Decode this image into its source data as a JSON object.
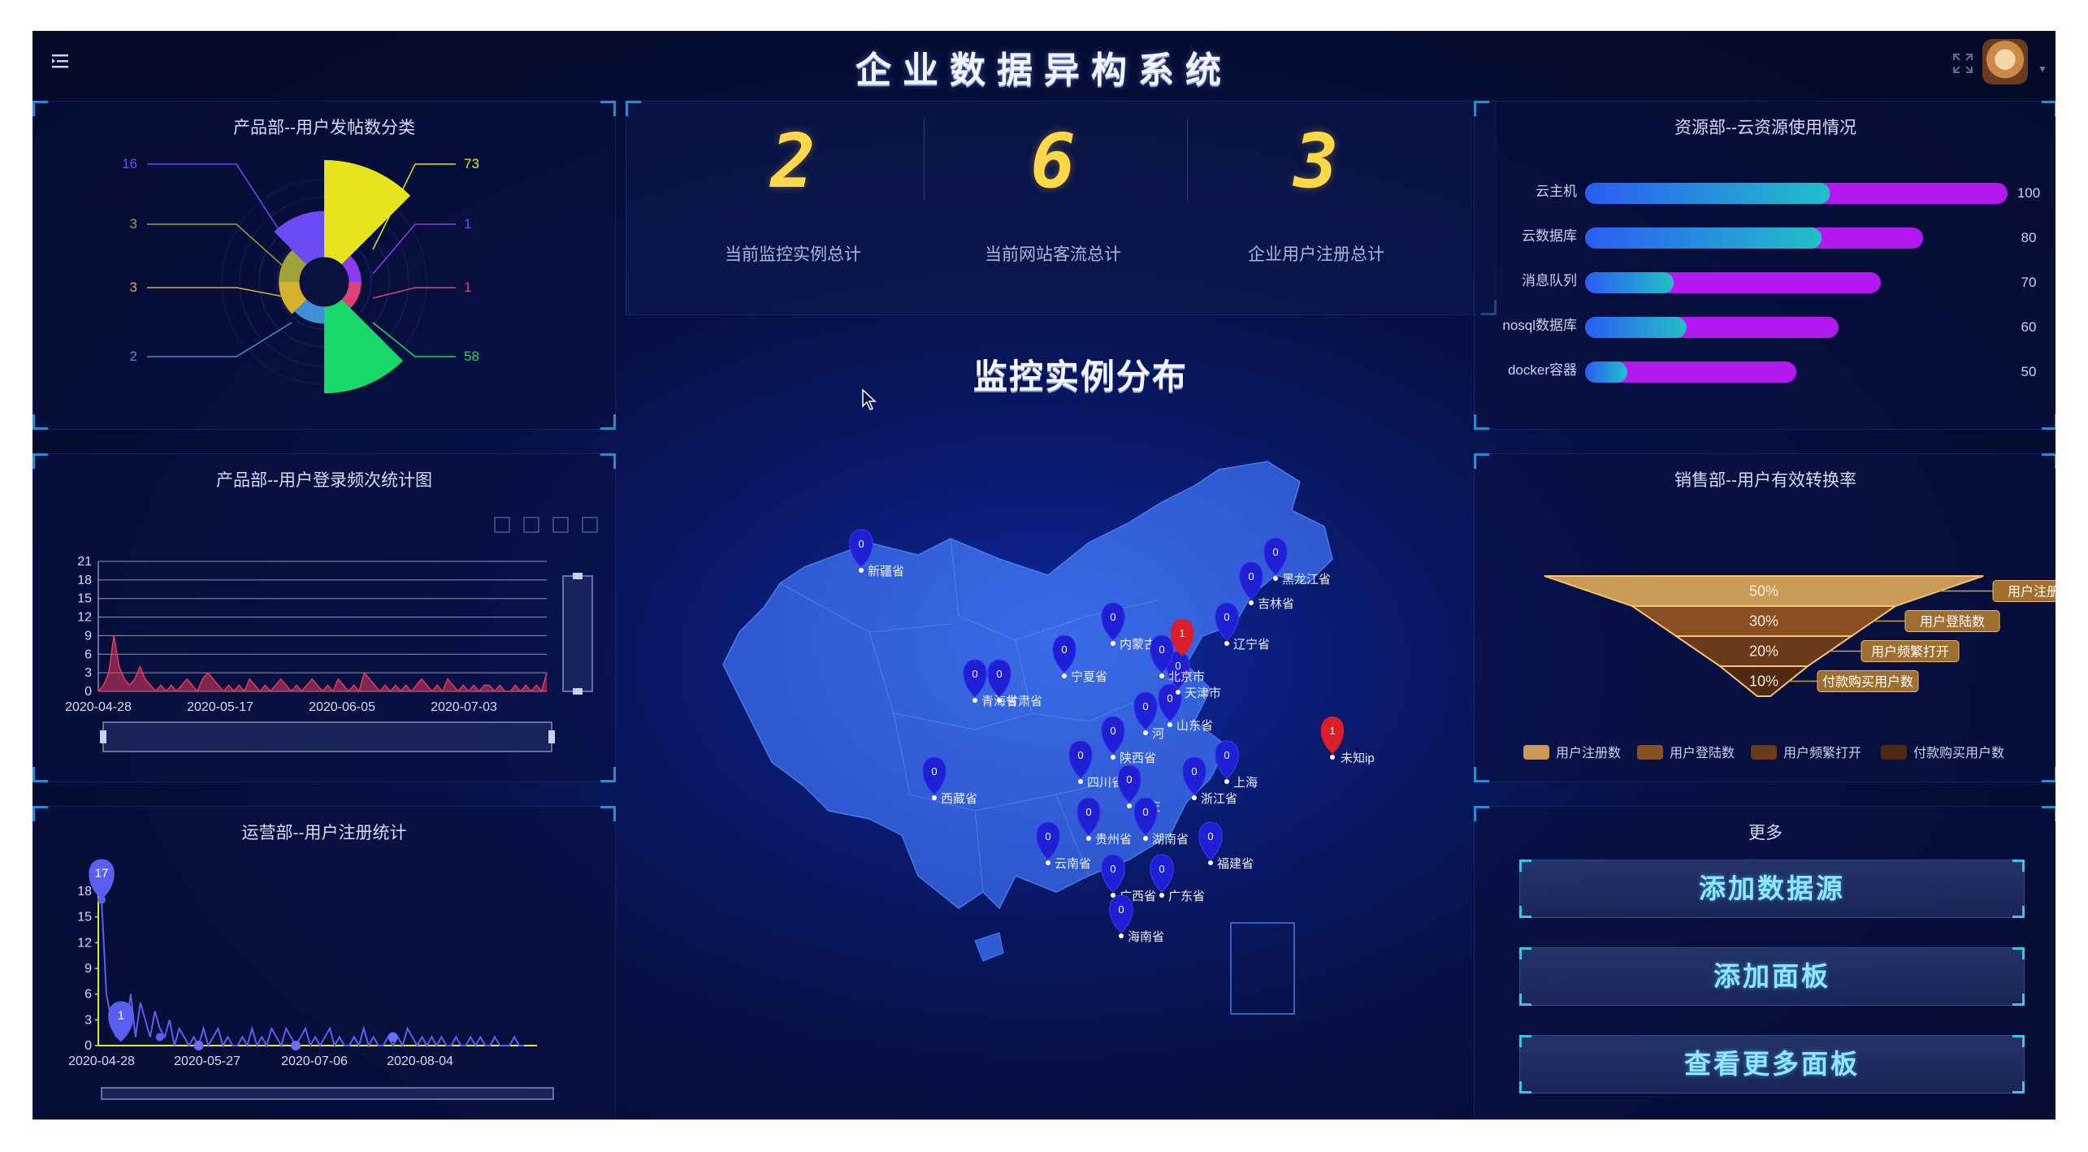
{
  "app": {
    "title": "企业数据异构系统"
  },
  "header": {
    "menu_icon": "menu-fold-icon",
    "fullscreen_icon": "fullscreen-icon",
    "avatar": "user-avatar"
  },
  "panels": {
    "post_category": {
      "title": "产品部--用户发帖数分类",
      "labels_left": [
        "16",
        "3",
        "3",
        "2"
      ],
      "labels_right": [
        "73",
        "1",
        "1",
        "58"
      ]
    },
    "login_freq": {
      "title": "产品部--用户登录频次统计图",
      "toolbar_icons": [
        "zoom-select-icon",
        "zoom-reset-icon",
        "refresh-icon",
        "download-icon"
      ]
    },
    "user_register": {
      "title": "运营部--用户注册统计"
    },
    "cloud_usage": {
      "title": "资源部--云资源使用情况"
    },
    "conversion": {
      "title": "销售部--用户有效转换率"
    },
    "more": {
      "title": "更多",
      "buttons": [
        "添加数据源",
        "添加面板",
        "查看更多面板"
      ]
    }
  },
  "stats": [
    {
      "value": "2",
      "label": "当前监控实例总计"
    },
    {
      "value": "6",
      "label": "当前网站客流总计"
    },
    {
      "value": "3",
      "label": "企业用户注册总计"
    }
  ],
  "map": {
    "title": "监控实例分布",
    "unknown_label": "未知ip",
    "labels": [
      "新疆省",
      "西藏省",
      "青海省",
      "甘肃省",
      "宁夏省",
      "内蒙古",
      "四川省",
      "陕西省",
      "重庆",
      "云南省",
      "贵州省",
      "广西省",
      "广东省",
      "湖南省",
      "福建省",
      "浙江省",
      "上海",
      "山东省",
      "天津市",
      "北京市",
      "辽宁省",
      "吉林省",
      "黑龙江省",
      "海南省",
      "河"
    ],
    "markers": [
      {
        "label": "新疆省",
        "value": 0,
        "color": "#1f1fd6"
      },
      {
        "label": "西藏省",
        "value": 0,
        "color": "#1f1fd6"
      },
      {
        "label": "北京市",
        "value": 1,
        "color": "#d9202a"
      },
      {
        "label": "未知ip",
        "value": 1,
        "color": "#d9202a"
      }
    ]
  },
  "chart_data": [
    {
      "type": "pie",
      "title": "产品部--用户发帖数分类",
      "variant": "nightingale-rose",
      "values": [
        73,
        1,
        1,
        58,
        2,
        3,
        3,
        16
      ],
      "colors": [
        "#e7e41d",
        "#8a3cf0",
        "#e0407a",
        "#18d86a",
        "#3f8fd8",
        "#d5b02a",
        "#9fa33a",
        "#6c4cf2"
      ]
    },
    {
      "type": "area",
      "title": "产品部--用户登录频次统计图",
      "x_ticks": [
        "2020-04-28",
        "2020-05-17",
        "2020-06-05",
        "2020-07-03"
      ],
      "y_ticks": [
        0,
        3,
        6,
        9,
        12,
        15,
        18,
        21
      ],
      "ylim": [
        0,
        21
      ],
      "series": [
        {
          "values": [
            0,
            1,
            3,
            9,
            4,
            2,
            1,
            2,
            4,
            2,
            1,
            0,
            1,
            0,
            1,
            0,
            1,
            2,
            1,
            0,
            2,
            3,
            2,
            1,
            0,
            1,
            0,
            1,
            0,
            2,
            1,
            0,
            1,
            0,
            1,
            2,
            1,
            0,
            1,
            0,
            1,
            2,
            1,
            0,
            1,
            0,
            2,
            1,
            0,
            1,
            0,
            3,
            2,
            1,
            0,
            1,
            0,
            1,
            0,
            1,
            0,
            1,
            2,
            1,
            0,
            1,
            0,
            2,
            1,
            0,
            1,
            0,
            1,
            0,
            1,
            1,
            0,
            1,
            0,
            0,
            1,
            0,
            1,
            0,
            1,
            0,
            3
          ]
        }
      ],
      "color": "#e23a5e"
    },
    {
      "type": "line",
      "title": "运营部--用户注册统计",
      "x_ticks": [
        "2020-04-28",
        "2020-05-27",
        "2020-07-06",
        "2020-08-04"
      ],
      "y_ticks": [
        0,
        3,
        6,
        9,
        12,
        15,
        18
      ],
      "ylim": [
        0,
        18
      ],
      "series": [
        {
          "values": [
            17,
            6,
            3,
            1,
            4,
            2,
            6,
            1,
            5,
            3,
            1,
            4,
            2,
            1,
            3,
            0,
            2,
            1,
            0,
            1,
            0,
            2,
            0,
            1,
            2,
            0,
            1,
            0,
            0,
            1,
            0,
            2,
            0,
            1,
            0,
            2,
            1,
            0,
            2,
            1,
            0,
            1,
            2,
            0,
            1,
            0,
            1,
            2,
            0,
            1,
            0,
            0,
            1,
            0,
            2,
            0,
            1,
            0,
            0,
            1,
            0,
            1,
            0,
            2,
            1,
            0,
            1,
            0,
            1,
            0,
            1,
            0,
            0,
            1,
            0,
            0,
            1,
            0,
            1,
            0,
            0,
            1,
            0,
            0,
            0,
            1,
            0,
            0
          ]
        }
      ],
      "annotations": [
        {
          "label": "17"
        },
        {
          "label": "1"
        }
      ],
      "color": "#5a5ff0",
      "axis_color": "#e8e43a"
    },
    {
      "type": "bar",
      "title": "资源部--云资源使用情况",
      "orientation": "horizontal",
      "categories": [
        "云主机",
        "云数据库",
        "消息队列",
        "nosql数据库",
        "docker容器"
      ],
      "values": [
        100,
        80,
        70,
        60,
        50
      ],
      "xlim": [
        0,
        100
      ],
      "colors": [
        "#2b5cf4",
        "#21c0c8",
        "#b318f0"
      ]
    },
    {
      "type": "funnel",
      "title": "销售部--用户有效转换率",
      "categories": [
        "用户注册数",
        "用户登陆数",
        "用户频繁打开",
        "付款购买用户数"
      ],
      "values": [
        50,
        30,
        20,
        10
      ],
      "value_labels": [
        "50%",
        "30%",
        "20%",
        "10%"
      ],
      "legend": [
        "用户注册数",
        "用户登陆数",
        "用户频繁打开",
        "付款购买用户数"
      ],
      "colors": [
        "#c99a55",
        "#8a4f22",
        "#6b3a1c",
        "#4e2a14"
      ]
    }
  ]
}
